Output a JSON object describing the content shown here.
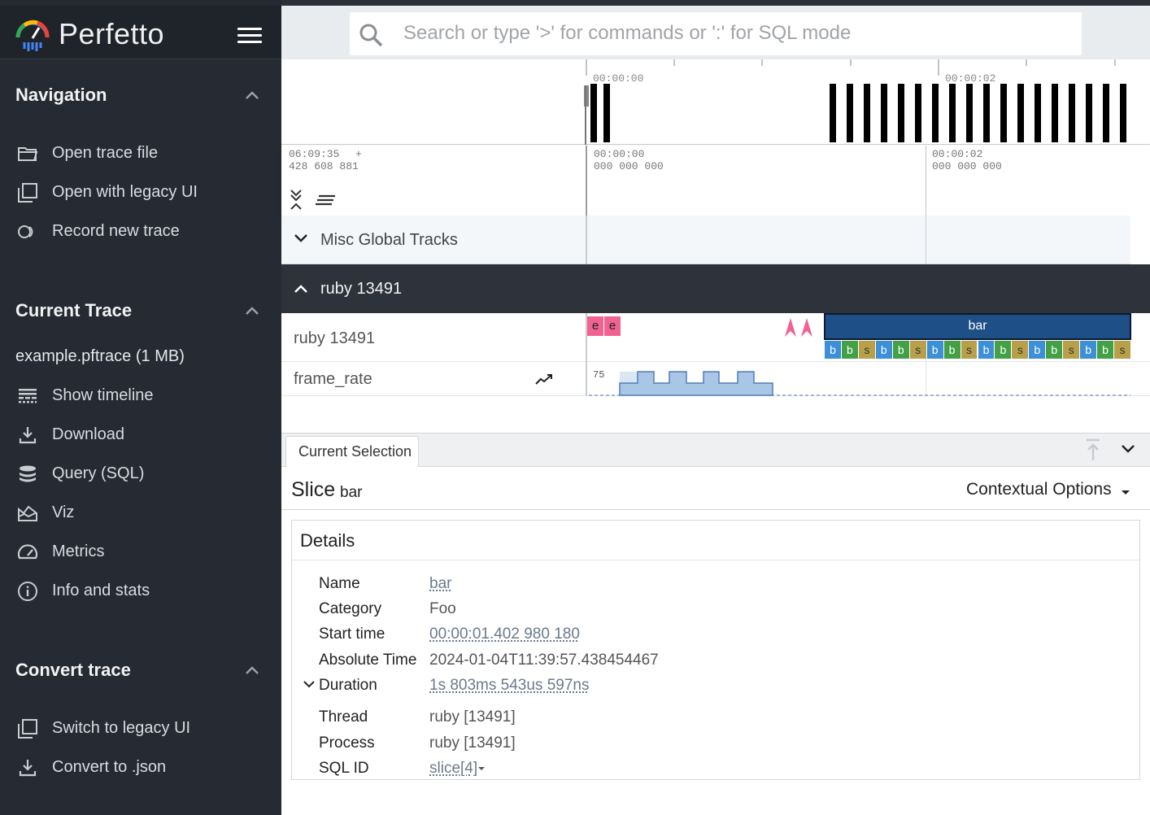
{
  "app": {
    "name": "Perfetto",
    "logo_icon": "perfetto-gauge-icon",
    "menu_icon": "hamburger-icon"
  },
  "search": {
    "placeholder": "Search or type '>' for commands or ':' for SQL mode",
    "icon": "search-icon"
  },
  "sidebar": {
    "navigation": {
      "title": "Navigation",
      "items": [
        {
          "label": "Open trace file",
          "icon": "folder-open-icon"
        },
        {
          "label": "Open with legacy UI",
          "icon": "filter-none-icon"
        },
        {
          "label": "Record new trace",
          "icon": "record-icon"
        }
      ]
    },
    "current_trace": {
      "title": "Current Trace",
      "file": "example.pftrace (1 MB)",
      "items": [
        {
          "label": "Show timeline",
          "icon": "timeline-icon"
        },
        {
          "label": "Download",
          "icon": "download-icon"
        },
        {
          "label": "Query (SQL)",
          "icon": "database-icon"
        },
        {
          "label": "Viz",
          "icon": "area-chart-icon"
        },
        {
          "label": "Metrics",
          "icon": "speed-gauge-icon"
        },
        {
          "label": "Info and stats",
          "icon": "info-icon"
        }
      ]
    },
    "convert_trace": {
      "title": "Convert trace",
      "items": [
        {
          "label": "Switch to legacy UI",
          "icon": "filter-none-icon"
        },
        {
          "label": "Convert to .json",
          "icon": "download-icon"
        }
      ]
    }
  },
  "timeline": {
    "overview_ticks": [
      "00:00:00",
      "00:00:02"
    ],
    "offset_time": "06:09:35",
    "offset_ns": "428 608 881",
    "offset_plus": "+",
    "axis_ticks": [
      {
        "time": "00:00:00",
        "ns": "000 000 000"
      },
      {
        "time": "00:00:02",
        "ns": "000 000 000"
      }
    ],
    "tracks": {
      "misc_title": "Misc Global Tracks",
      "process_title": "ruby 13491",
      "thread_track": "ruby 13491",
      "counter_track": "frame_rate",
      "counter_max": "75"
    },
    "slices": {
      "e1": "e",
      "e2": "e",
      "bar": "bar",
      "children": [
        "b",
        "b",
        "s",
        "b",
        "b",
        "s",
        "b",
        "b",
        "s",
        "b",
        "b",
        "s",
        "b",
        "b",
        "s",
        "b",
        "b",
        "s"
      ]
    },
    "colors": {
      "slice_bar": "#1e4f86",
      "slice_pink": "#f06292",
      "child_b1": "#3d8fd6",
      "child_b2": "#43a047",
      "child_s": "#b8a04a",
      "counter_fill": "#a9c6e6",
      "counter_line": "#4d7eb8"
    }
  },
  "panel": {
    "tab": "Current Selection",
    "kind": "Slice",
    "name": "bar",
    "contextual": "Contextual Options",
    "details_title": "Details",
    "rows": [
      {
        "key": "Name",
        "value": "bar",
        "link": true
      },
      {
        "key": "Category",
        "value": "Foo",
        "link": false
      },
      {
        "key": "Start time",
        "value": "00:00:01.402 980 180",
        "link": true
      },
      {
        "key": "Absolute Time",
        "value": "2024-01-04T11:39:57.438454467",
        "link": false
      },
      {
        "key": "Duration",
        "value": "1s 803ms 543us 597ns",
        "link": true
      },
      {
        "key": "Thread",
        "value": "ruby [13491]",
        "link": false
      },
      {
        "key": "Process",
        "value": "ruby [13491]",
        "link": false
      },
      {
        "key": "SQL ID",
        "value": "slice[4]",
        "link": true
      }
    ]
  }
}
